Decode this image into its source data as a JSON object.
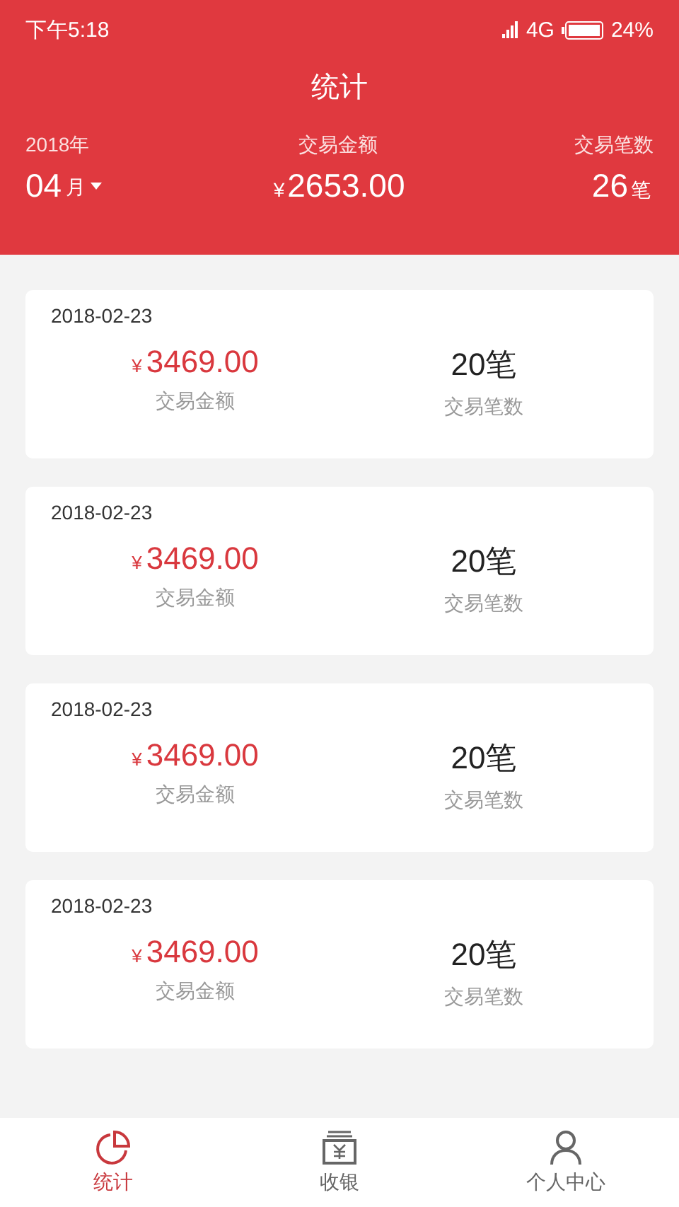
{
  "status_bar": {
    "time": "下午5:18",
    "network": "4G",
    "battery": "24%"
  },
  "header": {
    "title": "统计",
    "year": "2018年",
    "month": "04",
    "month_unit": "月",
    "amount_label": "交易金额",
    "currency": "¥",
    "amount": "2653.00",
    "count_label": "交易笔数",
    "count": "26",
    "count_unit": "笔"
  },
  "records": [
    {
      "date": "2018-02-23",
      "currency": "¥",
      "amount": "3469.00",
      "amount_label": "交易金额",
      "count": "20笔",
      "count_label": "交易笔数"
    },
    {
      "date": "2018-02-23",
      "currency": "¥",
      "amount": "3469.00",
      "amount_label": "交易金额",
      "count": "20笔",
      "count_label": "交易笔数"
    },
    {
      "date": "2018-02-23",
      "currency": "¥",
      "amount": "3469.00",
      "amount_label": "交易金额",
      "count": "20笔",
      "count_label": "交易笔数"
    },
    {
      "date": "2018-02-23",
      "currency": "¥",
      "amount": "3469.00",
      "amount_label": "交易金额",
      "count": "20笔",
      "count_label": "交易笔数"
    }
  ],
  "tabs": [
    {
      "kind": "chart",
      "label": "统计",
      "selected": true
    },
    {
      "kind": "cash",
      "label": "收银",
      "selected": false
    },
    {
      "kind": "person",
      "label": "个人中心",
      "selected": false
    }
  ]
}
